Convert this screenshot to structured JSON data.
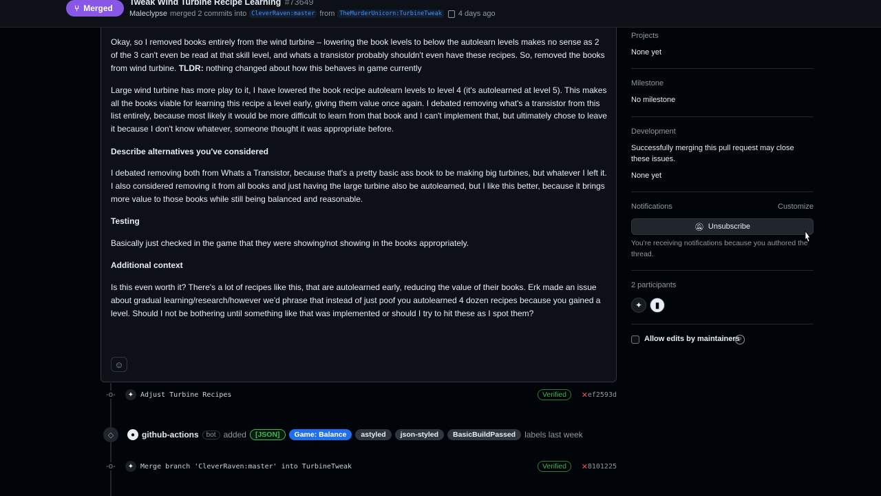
{
  "header": {
    "status": "Merged",
    "title": "Tweak Wind Turbine Recipe Learning",
    "number": "#73649",
    "author": "Maleclypse",
    "merged_text": "merged 2 commits into",
    "base_branch": "CleverRaven:master",
    "from_text": "from",
    "head_branch": "TheMurderUnicorn:TurbineTweak",
    "time": "4 days ago"
  },
  "comment": {
    "p1": "Okay, so I removed books entirely from the wind turbine – lowering the book levels to below the autolearn levels makes no sense as 2 of the 3 can't even be read at that skill level, and whats a transistor probably shouldn't even have these recipes. So, removed the books from wind turbine.",
    "p1_bold": "TLDR:",
    "p1_tail": "nothing changed about how this behaves in game currently",
    "p2": "Large wind turbine has more play to it, I have lowered the book recipe autolearn levels to level 4 (it's autolearned at level 5). This makes all the books viable for learning this recipe a level early, giving them value once again. I debated removing what's a transistor from this list entirely, because most likely it would be more difficult to learn from that book and I can't implement that, but ultimately chose to leave it because I don't know whatever, someone thought it was appropriate before.",
    "h_alternatives": "Describe alternatives you've considered",
    "p3": "I debated removing both from Whats a Transistor, because that's a pretty basic ass book to be making big turbines, but whatever I left it. I also considered removing it from all books and just having the large turbine also be autolearned, but I like this better, because it brings more value to those books while still being balanced and reasonable.",
    "h_testing": "Testing",
    "p4": "Basically just checked in the game that they were showing/not showing in the books appropriately.",
    "h_context": "Additional context",
    "p5": "Is this even worth it? There's a lot of recipes like this, that are autolearned early, reducing the value of their books. Erk made an issue about gradual learning/research/however we'd phrase that instead of just poof you autolearned 4 dozen recipes because you gained a level. Should I not be bothering until something like that was implemented or should I try to hit these as I spot them?"
  },
  "timeline": {
    "commit1": {
      "message": "Adjust Turbine Recipes",
      "verified": "Verified",
      "sha": "ef2593d"
    },
    "label_event": {
      "actor": "github-actions",
      "bot": "bot",
      "added": "added",
      "labels": [
        {
          "name": "[JSON]",
          "bg": "#2ea04326",
          "fg": "#3fb950",
          "border": "#3fb950"
        },
        {
          "name": "Game: Balance",
          "bg": "#1f6feb",
          "fg": "#ffffff",
          "border": "#1f6feb"
        },
        {
          "name": "astyled",
          "bg": "#30363d",
          "fg": "#e6edf3",
          "border": "#30363d"
        },
        {
          "name": "json-styled",
          "bg": "#30363d",
          "fg": "#e6edf3",
          "border": "#30363d"
        },
        {
          "name": "BasicBuildPassed",
          "bg": "#30363d",
          "fg": "#e6edf3",
          "border": "#30363d"
        }
      ],
      "suffix": "labels last week"
    },
    "commit2": {
      "message": "Merge branch 'CleverRaven:master' into TurbineTweak",
      "verified": "Verified",
      "sha": "8101225"
    }
  },
  "sidebar": {
    "projects": {
      "heading": "Projects",
      "value": "None yet"
    },
    "milestone": {
      "heading": "Milestone",
      "value": "No milestone"
    },
    "development": {
      "heading": "Development",
      "note": "Successfully merging this pull request may close these issues.",
      "value": "None yet"
    },
    "notifications": {
      "heading": "Notifications",
      "customize": "Customize",
      "button": "Unsubscribe",
      "note": "You're receiving notifications because you authored the thread."
    },
    "participants": {
      "heading": "2 participants"
    },
    "allow_edits": "Allow edits by maintainers"
  }
}
